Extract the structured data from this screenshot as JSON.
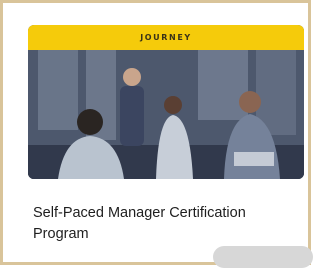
{
  "card": {
    "badge_label": "JOURNEY",
    "title": "Self-Paced Manager Certification Program",
    "image_subject": "team-meeting-photo"
  },
  "colors": {
    "badge_background": "#f5cb0b",
    "frame_border": "#d9c49a",
    "title_text": "#1e1e1e"
  }
}
